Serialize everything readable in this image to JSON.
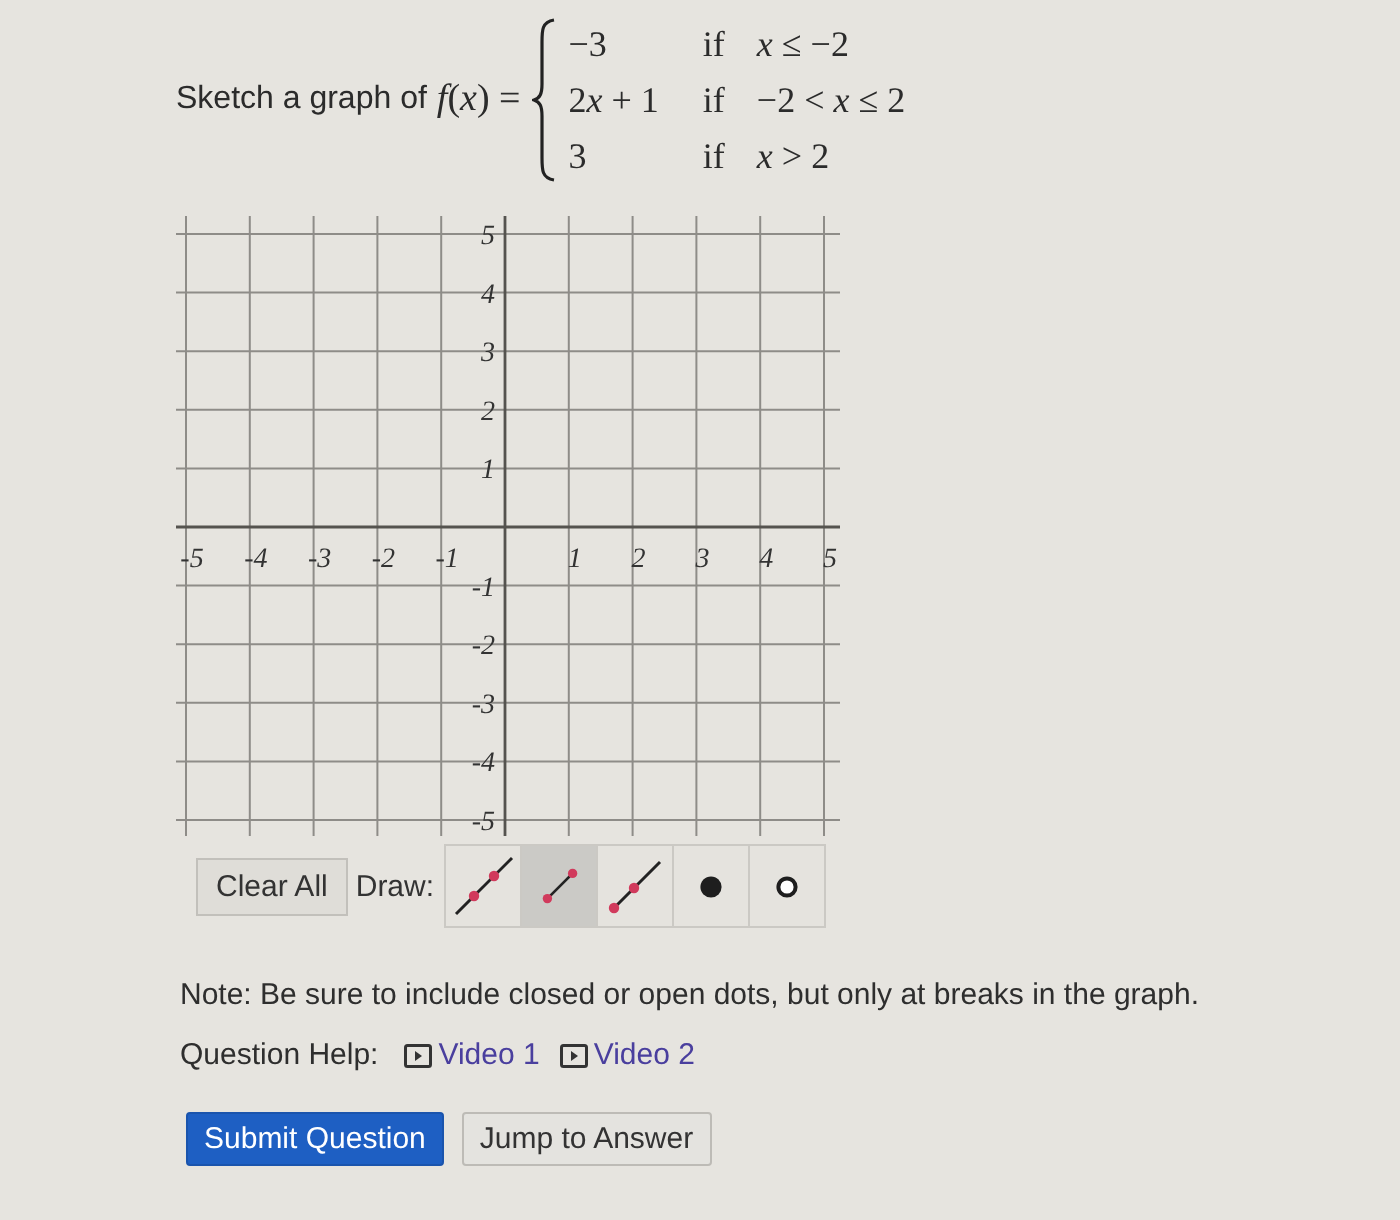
{
  "question": {
    "lead": "Sketch a graph of",
    "function": "f(x) =",
    "cases": [
      {
        "value": "−3",
        "keyword": "if",
        "condition": "x ≤ −2"
      },
      {
        "value": "2x + 1",
        "keyword": "if",
        "condition": "−2 < x ≤ 2"
      },
      {
        "value": "3",
        "keyword": "if",
        "condition": "x > 2"
      }
    ]
  },
  "graph": {
    "x_labels": [
      "-5",
      "-4",
      "-3",
      "-2",
      "-1",
      "1",
      "2",
      "3",
      "4",
      "5"
    ],
    "y_labels": [
      "5",
      "4",
      "3",
      "2",
      "1",
      "-1",
      "-2",
      "-3",
      "-4",
      "-5"
    ]
  },
  "toolbar": {
    "clear_button": "Clear All",
    "draw_label": "Draw:",
    "tools": [
      {
        "kind": "line",
        "selected": false
      },
      {
        "kind": "segment",
        "selected": true
      },
      {
        "kind": "ray",
        "selected": false
      },
      {
        "kind": "closed_dot",
        "selected": false
      },
      {
        "kind": "open_dot",
        "selected": false
      }
    ]
  },
  "note": "Note: Be sure to include closed or open dots, but only at breaks in the graph.",
  "help": {
    "label": "Question Help:",
    "links": [
      "Video 1",
      "Video 2"
    ]
  },
  "buttons": [
    {
      "label": "Submit Question",
      "kind": "primary"
    },
    {
      "label": "Jump to Answer",
      "kind": "secondary"
    }
  ]
}
